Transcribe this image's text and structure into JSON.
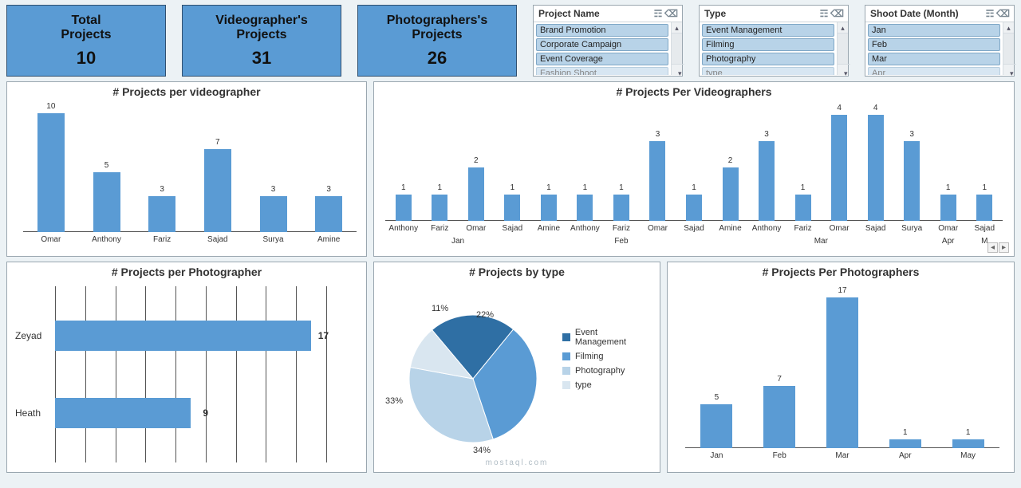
{
  "kpis": {
    "total": {
      "title1": "Total",
      "title2": "Projects",
      "value": "10"
    },
    "video": {
      "title1": "Videographer's",
      "title2": "Projects",
      "value": "31"
    },
    "photo": {
      "title1": "Photographers's",
      "title2": "Projects",
      "value": "26"
    }
  },
  "slicers": {
    "project": {
      "title": "Project Name",
      "items": [
        "Brand Promotion",
        "Corporate Campaign",
        "Event Coverage",
        "Fashion Shoot"
      ]
    },
    "type": {
      "title": "Type",
      "items": [
        "Event Management",
        "Filming",
        "Photography",
        "type"
      ]
    },
    "month": {
      "title": "Shoot Date (Month)",
      "items": [
        "Jan",
        "Feb",
        "Mar",
        "Apr"
      ]
    }
  },
  "charts": {
    "vid1": {
      "title": "# Projects per videographer"
    },
    "vid2": {
      "title": "# Projects Per Videographers"
    },
    "photo1": {
      "title": "# Projects per Photographer"
    },
    "pie": {
      "title": "# Projects by type"
    },
    "photo2": {
      "title": "# Projects Per Photographers"
    }
  },
  "pie_legend": [
    "Event Management",
    "Filming",
    "Photography",
    "type"
  ],
  "pie_labels": {
    "em": "22%",
    "fl": "34%",
    "ph": "33%",
    "ty": "11%"
  },
  "photo_labels": {
    "zeyad": "Zeyad",
    "heath": "Heath",
    "zv": "17",
    "hv": "9"
  },
  "watermark": "mostaql.com",
  "chart_data": [
    {
      "id": "vid1",
      "type": "bar",
      "title": "# Projects per videographer",
      "categories": [
        "Omar",
        "Anthony",
        "Fariz",
        "Sajad",
        "Surya",
        "Amine"
      ],
      "values": [
        10,
        5,
        3,
        7,
        3,
        3
      ],
      "ymax": 10
    },
    {
      "id": "vid2",
      "type": "bar",
      "title": "# Projects Per Videographers",
      "group_by": "month",
      "groups": [
        "Jan",
        "Feb",
        "Mar",
        "Apr",
        "May"
      ],
      "points": [
        {
          "g": "Jan",
          "c": "Anthony",
          "v": 1
        },
        {
          "g": "Jan",
          "c": "Fariz",
          "v": 1
        },
        {
          "g": "Jan",
          "c": "Omar",
          "v": 2
        },
        {
          "g": "Jan",
          "c": "Sajad",
          "v": 1
        },
        {
          "g": "Feb",
          "c": "Amine",
          "v": 1
        },
        {
          "g": "Feb",
          "c": "Anthony",
          "v": 1
        },
        {
          "g": "Feb",
          "c": "Fariz",
          "v": 1
        },
        {
          "g": "Feb",
          "c": "Omar",
          "v": 3
        },
        {
          "g": "Feb",
          "c": "Sajad",
          "v": 1
        },
        {
          "g": "Mar",
          "c": "Amine",
          "v": 2
        },
        {
          "g": "Mar",
          "c": "Anthony",
          "v": 3
        },
        {
          "g": "Mar",
          "c": "Fariz",
          "v": 1
        },
        {
          "g": "Mar",
          "c": "Omar",
          "v": 4
        },
        {
          "g": "Mar",
          "c": "Sajad",
          "v": 4
        },
        {
          "g": "Mar",
          "c": "Surya",
          "v": 3
        },
        {
          "g": "Apr",
          "c": "Omar",
          "v": 1
        },
        {
          "g": "May",
          "c": "Sajad",
          "v": 1
        }
      ],
      "ymax": 4
    },
    {
      "id": "photo1",
      "type": "bar",
      "orientation": "h",
      "title": "# Projects per Photographer",
      "categories": [
        "Zeyad",
        "Heath"
      ],
      "values": [
        17,
        9
      ],
      "xmax": 18
    },
    {
      "id": "pie",
      "type": "pie",
      "title": "# Projects by type",
      "series": [
        {
          "name": "Event Management",
          "value": 22,
          "color": "#2f6fa4"
        },
        {
          "name": "Filming",
          "value": 34,
          "color": "#5a9bd4"
        },
        {
          "name": "Photography",
          "value": 33,
          "color": "#b8d3e8"
        },
        {
          "name": "type",
          "value": 11,
          "color": "#d9e6f0"
        }
      ]
    },
    {
      "id": "photo2",
      "type": "bar",
      "title": "# Projects Per Photographers",
      "categories": [
        "Jan",
        "Feb",
        "Mar",
        "Apr",
        "May"
      ],
      "values": [
        5,
        7,
        17,
        1,
        1
      ],
      "ymax": 17
    }
  ]
}
